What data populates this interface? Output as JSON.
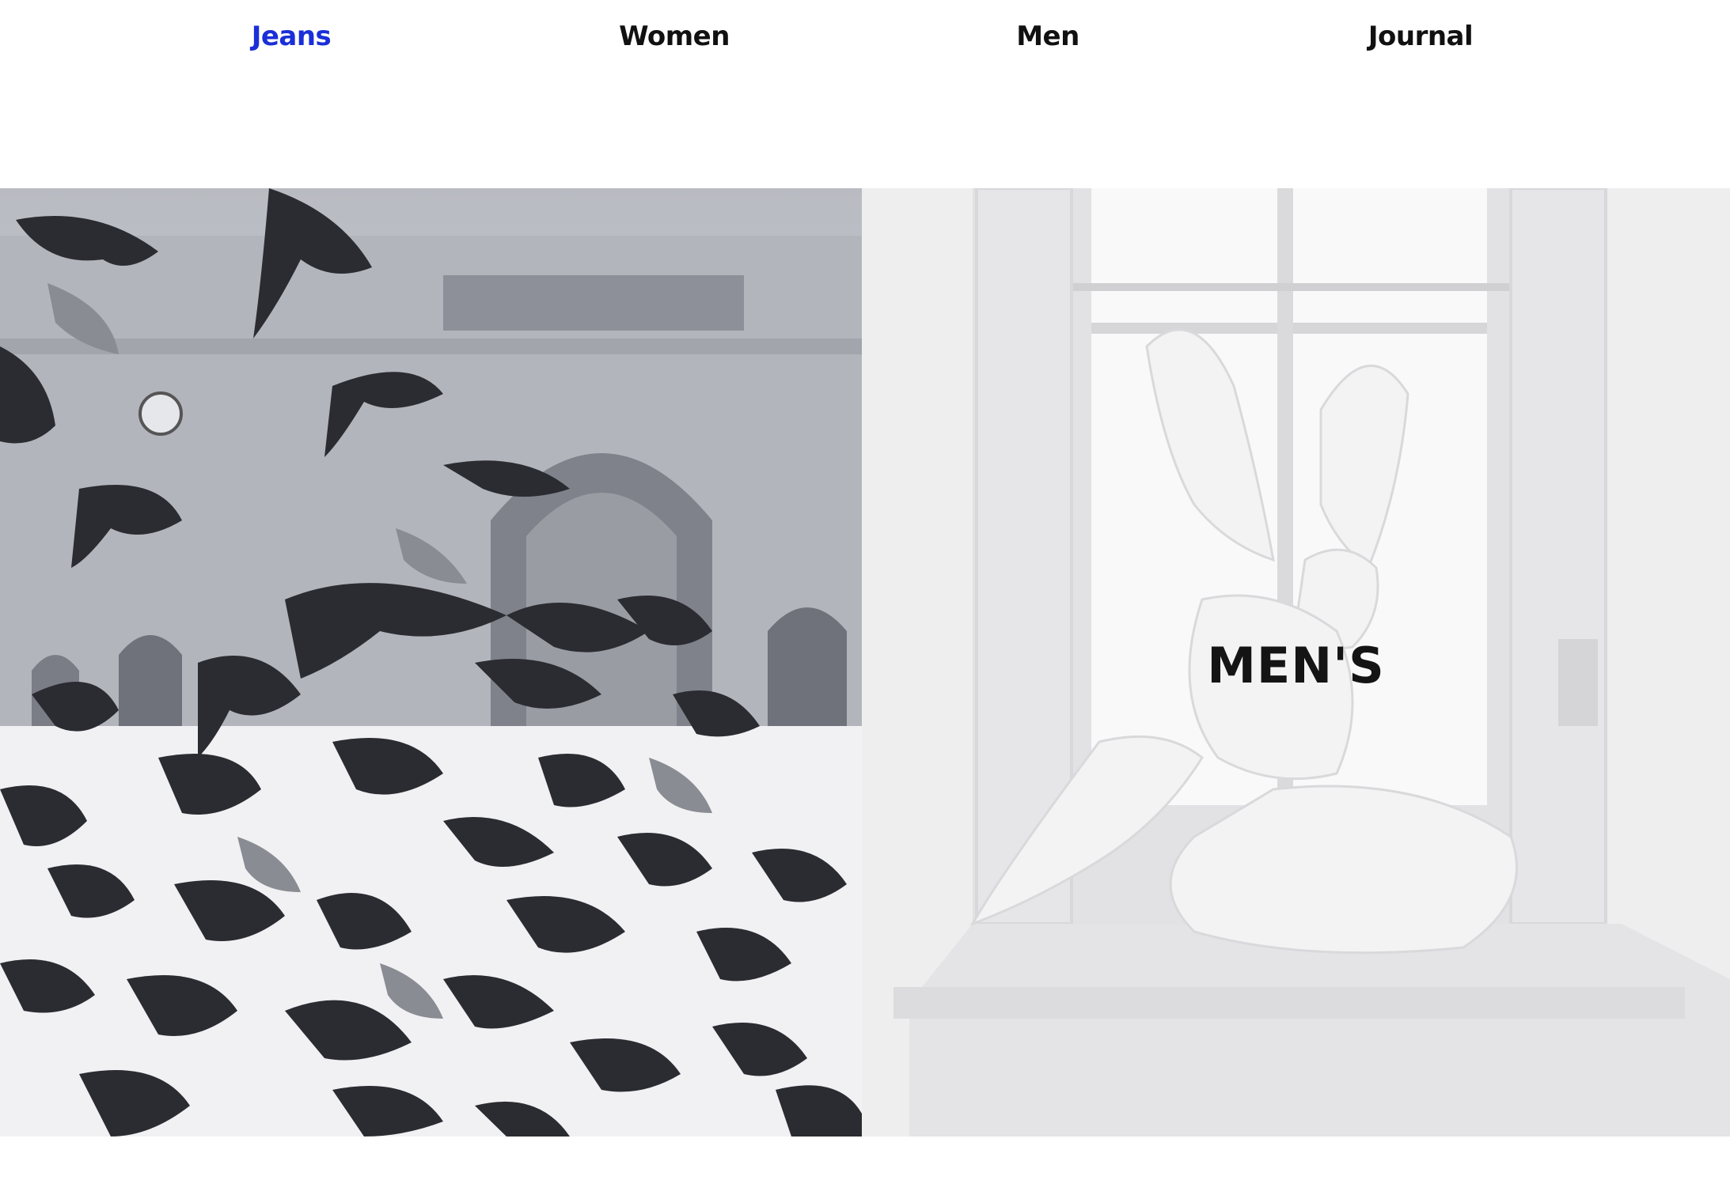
{
  "nav": {
    "items": [
      {
        "label": "Jeans",
        "active": true
      },
      {
        "label": "Women",
        "active": false
      },
      {
        "label": "Men",
        "active": false
      },
      {
        "label": "Journal",
        "active": false
      }
    ],
    "active_color": "#1a2fd8",
    "default_color": "#111111"
  },
  "hero": {
    "left_panel": {
      "image": "pigeons-in-snow-photo"
    },
    "right_panel": {
      "image": "statue-by-window-photo",
      "overlay_title": "MEN'S"
    }
  }
}
